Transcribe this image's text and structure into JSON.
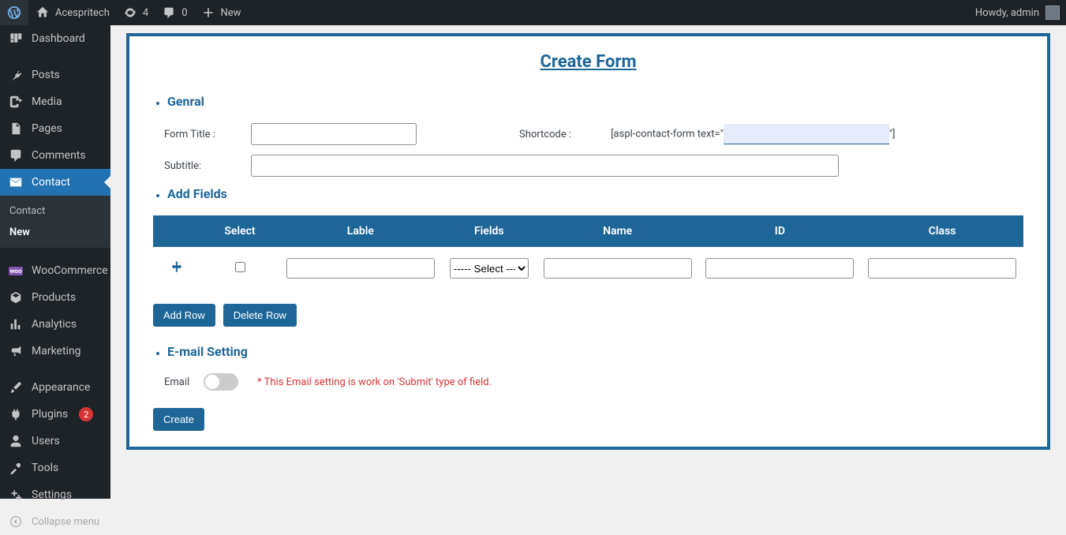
{
  "adminbar": {
    "site_name": "Acespritech",
    "updates_count": "4",
    "comments_count": "0",
    "new_label": "New",
    "howdy": "Howdy, admin"
  },
  "sidebar": {
    "dashboard": "Dashboard",
    "posts": "Posts",
    "media": "Media",
    "pages": "Pages",
    "comments": "Comments",
    "contact": "Contact",
    "contact_sub1": "Contact",
    "contact_sub2": "New",
    "woocommerce": "WooCommerce",
    "products": "Products",
    "analytics": "Analytics",
    "marketing": "Marketing",
    "appearance": "Appearance",
    "plugins": "Plugins",
    "plugins_badge": "2",
    "users": "Users",
    "tools": "Tools",
    "settings": "Settings",
    "collapse": "Collapse menu"
  },
  "page": {
    "title": "Create Form",
    "section_general": "Genral",
    "form_title_label": "Form Title :",
    "shortcode_label": "Shortcode :",
    "shortcode_prefix": "[aspl-contact-form text=\"",
    "shortcode_suffix": "\"]",
    "subtitle_label": "Subtitle:",
    "section_addfields": "Add Fields",
    "table": {
      "headers": [
        "Select",
        "Lable",
        "Fields",
        "Name",
        "ID",
        "Class"
      ],
      "select_default": "----- Select ----"
    },
    "add_row": "Add Row",
    "delete_row": "Delete Row",
    "section_email": "E-mail Setting",
    "email_label": "Email",
    "email_warning": "* This Email setting is work on 'Submit' type of field.",
    "create_btn": "Create"
  }
}
